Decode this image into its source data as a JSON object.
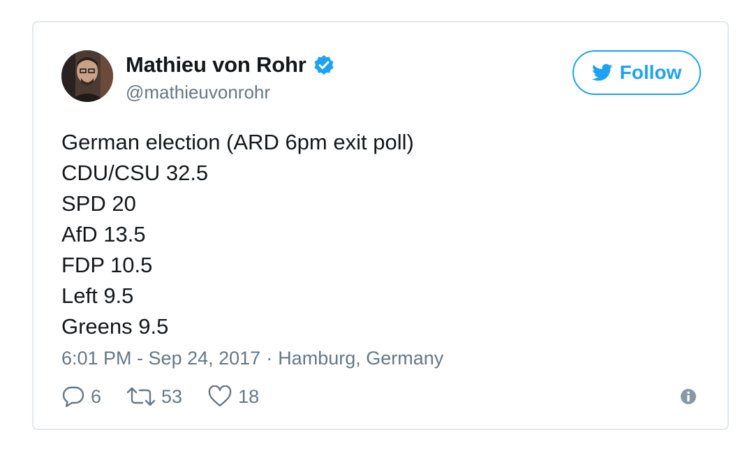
{
  "tweet": {
    "author": {
      "display_name": "Mathieu von Rohr",
      "handle": "@mathieuvonrohr",
      "verified": true
    },
    "follow_label": "Follow",
    "lines": [
      "German election (ARD 6pm exit poll)",
      "CDU/CSU 32.5",
      "SPD 20",
      "AfD 13.5",
      "FDP 10.5",
      "Left 9.5",
      "Greens 9.5"
    ],
    "time": "6:01 PM - Sep 24, 2017",
    "separator": "·",
    "location": "Hamburg, Germany",
    "actions": {
      "replies": "6",
      "retweets": "53",
      "likes": "18"
    }
  },
  "colors": {
    "accent": "#1da1f2",
    "text": "#14171a",
    "muted": "#657786",
    "border": "#e1e8ed"
  },
  "icons": {
    "verified": "verified-badge-icon",
    "follow": "twitter-bird-icon",
    "reply": "reply-bubble-icon",
    "retweet": "retweet-icon",
    "like": "heart-icon",
    "info": "info-icon"
  }
}
